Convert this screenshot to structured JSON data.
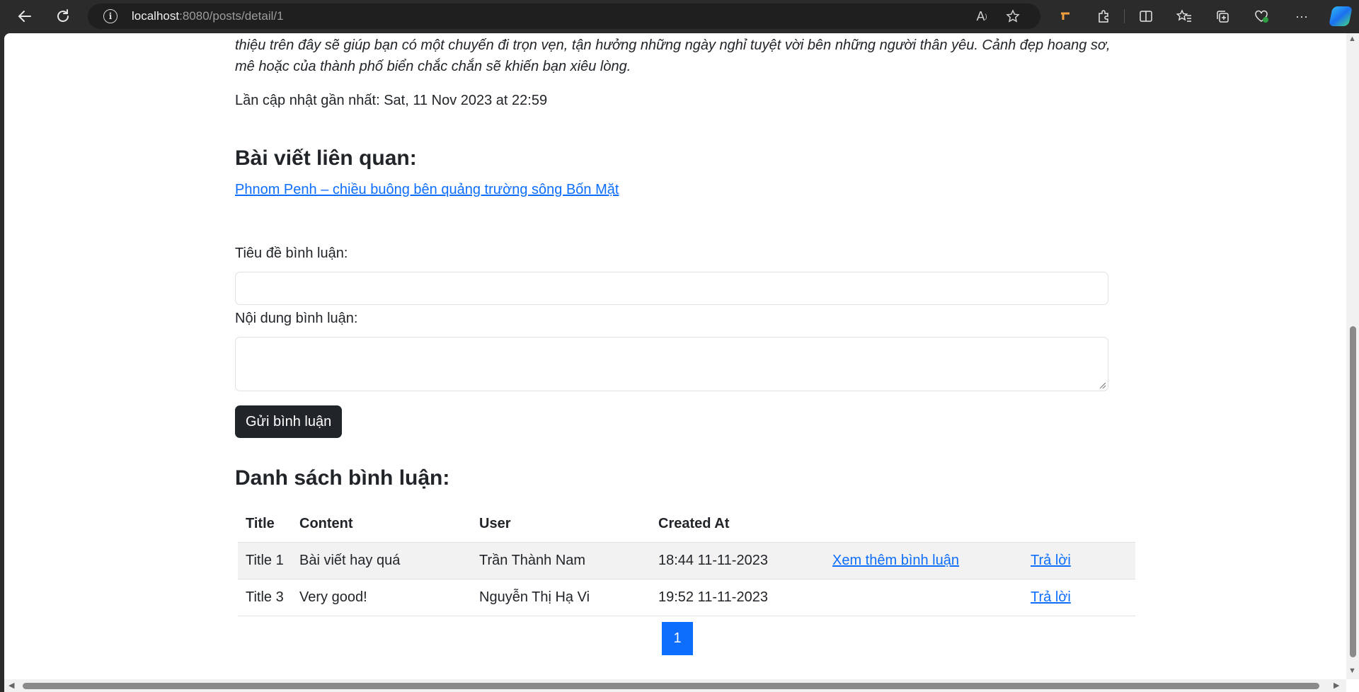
{
  "browser": {
    "url_host": "localhost",
    "url_rest": ":8080/posts/detail/1",
    "icons": {
      "back": "back-arrow-icon",
      "reload": "reload-icon",
      "info": "site-info-icon",
      "read_aloud": "read-aloud-icon",
      "favorite": "star-icon",
      "extension": "puzzle-icon",
      "split": "split-screen-icon",
      "favorites": "favorites-icon",
      "collections": "collections-icon",
      "health": "browser-essentials-icon",
      "more": "more-icon",
      "copilot": "copilot-icon"
    },
    "info_glyph": "i",
    "read_aloud_glyph": "A",
    "more_glyph": "···"
  },
  "post": {
    "intro_line1": "thiệu trên đây sẽ giúp bạn có một chuyến đi trọn vẹn, tận hưởng những ngày nghỉ tuyệt vời bên những người thân yêu. Cảnh đẹp hoang sơ,",
    "intro_line2": "mê hoặc của thành phố biển chắc chắn sẽ khiến bạn xiêu lòng.",
    "last_updated_label": "Lần cập nhật gần nhất: ",
    "last_updated_value": "Sat, 11 Nov 2023 at 22:59"
  },
  "related": {
    "heading": "Bài viết liên quan:",
    "links": [
      "Phnom Penh – chiều buông bên quảng trường sông Bốn Mặt"
    ]
  },
  "comment_form": {
    "title_label": "Tiêu đề bình luận:",
    "title_value": "",
    "content_label": "Nội dung bình luận:",
    "content_value": "",
    "submit_label": "Gửi bình luận"
  },
  "comments": {
    "heading": "Danh sách bình luận:",
    "columns": [
      "Title",
      "Content",
      "User",
      "Created At"
    ],
    "rows": [
      {
        "title": "Title 1",
        "content": "Bài viết hay quá",
        "user": "Trần Thành Nam",
        "created_at": "18:44 11-11-2023",
        "more": "Xem thêm bình luận",
        "reply": "Trả lời"
      },
      {
        "title": "Title 3",
        "content": "Very good!",
        "user": "Nguyễn Thị Hạ Vi",
        "created_at": "19:52 11-11-2023",
        "more": "",
        "reply": "Trả lời"
      }
    ],
    "pagination": {
      "current": "1"
    }
  },
  "colors": {
    "link": "#0d6efd",
    "button_dark": "#212529",
    "page_active": "#0d6efd"
  }
}
